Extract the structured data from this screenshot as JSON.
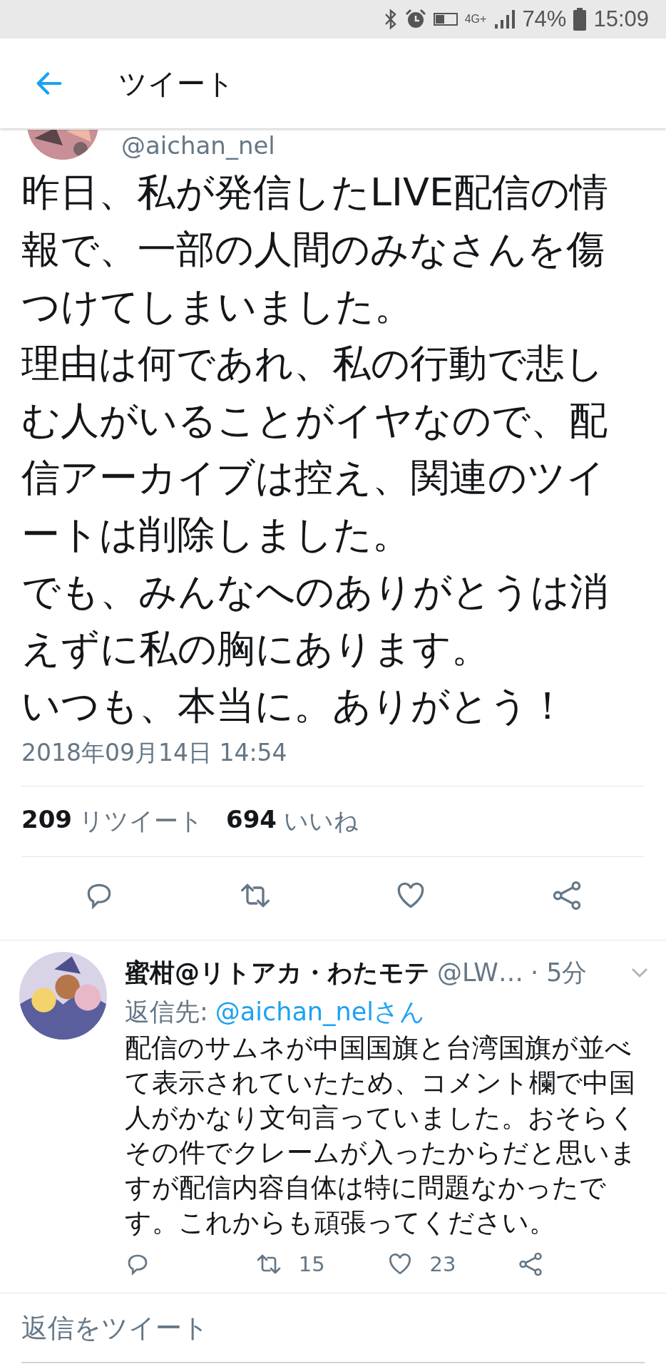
{
  "status_bar": {
    "network": "4G+",
    "battery": "74%",
    "time": "15:09"
  },
  "header": {
    "title": "ツイート"
  },
  "tweet": {
    "handle": "@aichan_nel",
    "paragraphs": [
      "昨日、私が発信したLIVE配信の情報で、一部の人間のみなさんを傷つけてしまいました。",
      "理由は何であれ、私の行動で悲しむ人がいることがイヤなので、配信アーカイブは控え、関連のツイートは削除しました。",
      "でも、みんなへのありがとうは消えずに私の胸にあります。",
      "いつも、本当に。ありがとう！"
    ],
    "timestamp": "2018年09月14日 14:54",
    "retweets": {
      "count": "209",
      "label": "リツイート"
    },
    "likes": {
      "count": "694",
      "label": "いいね"
    }
  },
  "replies": [
    {
      "name": "蜜柑@リトアカ・わたモテ",
      "handle": "@LW…",
      "time": "· 5分",
      "reply_to_label": "返信先:",
      "reply_to": "@aichan_nelさん",
      "text": "配信のサムネが中国国旗と台湾国旗が並べて表示されていたため、コメント欄で中国人がかなり文句言っていました。おそらくその件でクレームが入ったからだと思いますが配信内容自体は特に問題なかったです。これからも頑張ってください。",
      "retweets": "15",
      "likes": "23"
    }
  ],
  "reply_composer": {
    "placeholder": "返信をツイート"
  }
}
